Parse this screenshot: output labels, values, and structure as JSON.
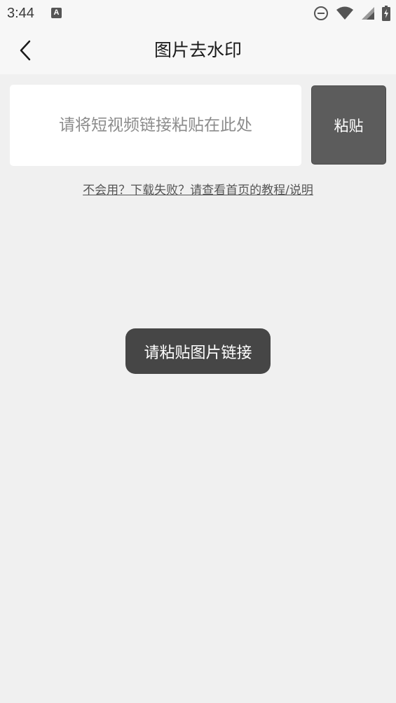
{
  "status_bar": {
    "time": "3:44",
    "left_icon": "text-a-icon",
    "icons": [
      "do-not-disturb-icon",
      "wifi-icon",
      "signal-icon",
      "battery-charging-icon"
    ]
  },
  "app_bar": {
    "back_icon": "chevron-left-icon",
    "title": "图片去水印"
  },
  "link_input": {
    "value": "",
    "placeholder": "请将短视频链接粘贴在此处"
  },
  "paste_button": {
    "label": "粘贴"
  },
  "help_link": {
    "text": "不会用？下载失败？请查看首页的教程/说明"
  },
  "toast": {
    "text": "请粘贴图片链接"
  },
  "colors": {
    "background": "#f0f0f0",
    "paste_button": "#5c5c5c",
    "toast": "#464646"
  }
}
